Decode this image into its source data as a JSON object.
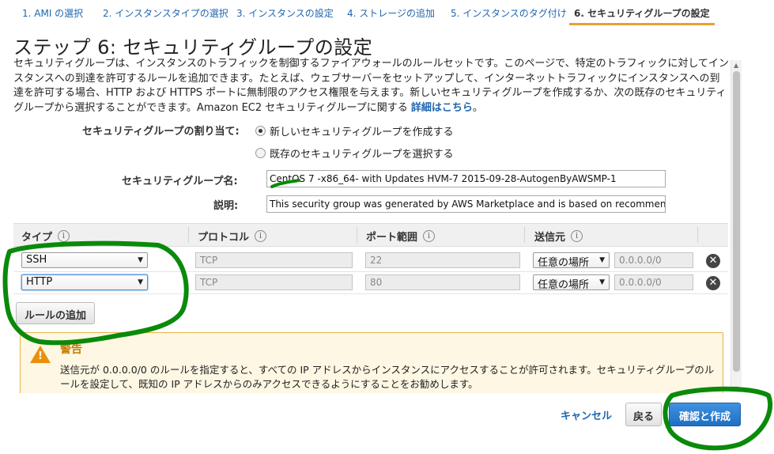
{
  "tabs": [
    {
      "label": "1. AMI の選択"
    },
    {
      "label": "2. インスタンスタイプの選択"
    },
    {
      "label": "3. インスタンスの設定"
    },
    {
      "label": "4. ストレージの追加"
    },
    {
      "label": "5. インスタンスのタグ付け"
    },
    {
      "label": "6. セキュリティグループの設定"
    }
  ],
  "page_title": "ステップ 6: セキュリティグループの設定",
  "description": {
    "text": "セキュリティグループは、インスタンスのトラフィックを制御するファイアウォールのルールセットです。このページで、特定のトラフィックに対してインスタンスへの到達を許可するルールを追加できます。たとえば、ウェブサーバーをセットアップして、インターネットトラフィックにインスタンスへの到達を許可する場合、HTTP および HTTPS ポートに無制限のアクセス権限を与えます。新しいセキュリティグループを作成するか、次の既存のセキュリティグループから選択することができます。Amazon EC2 セキュリティグループに関する ",
    "link": "詳細はこちら",
    "suffix": "。"
  },
  "assign": {
    "label": "セキュリティグループの割り当て:",
    "option_new": "新しいセキュリティグループを作成する",
    "option_existing": "既存のセキュリティグループを選択する",
    "selected": "new"
  },
  "group_name": {
    "label": "セキュリティグループ名:",
    "value": "CentOS 7 -x86_64- with Updates HVM-7 2015-09-28-AutogenByAWSMP-1"
  },
  "group_desc": {
    "label": "説明:",
    "value": "This security group was generated by AWS Marketplace and is based on recommende"
  },
  "table": {
    "headers": [
      "タイプ",
      "プロトコル",
      "ポート範囲",
      "送信元"
    ],
    "info_glyph": "i",
    "rows": [
      {
        "type": "SSH",
        "protocol": "TCP",
        "port": "22",
        "source": "任意の場所",
        "cidr": "0.0.0.0/0"
      },
      {
        "type": "HTTP",
        "protocol": "TCP",
        "port": "80",
        "source": "任意の場所",
        "cidr": "0.0.0.0/0"
      }
    ],
    "delete_glyph": "✕"
  },
  "add_rule_label": "ルールの追加",
  "warning": {
    "title": "警告",
    "glyph": "!",
    "text": "送信元が 0.0.0.0/0 のルールを指定すると、すべての IP アドレスからインスタンスにアクセスすることが許可されます。セキュリティグループのルールを設定して、既知の IP アドレスからのみアクセスできるようにすることをお勧めします。"
  },
  "footer": {
    "cancel": "キャンセル",
    "back": "戻る",
    "review": "確認と作成"
  },
  "colors": {
    "link": "#1f66b0",
    "tab_active_underline": "#e8a033",
    "warning_bg": "#fdf7e3",
    "primary": "#1e6fc4",
    "annotation_green": "#0a8a0a"
  }
}
